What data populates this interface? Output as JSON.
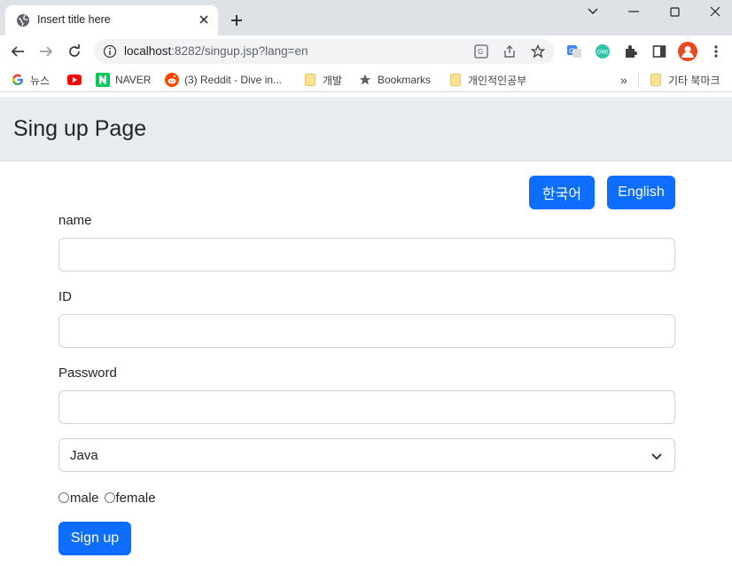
{
  "browser": {
    "tab": {
      "title": "Insert title here"
    },
    "address": {
      "host": "localhost",
      "rest": ":8282/singup.jsp?lang=en"
    },
    "bookmarks": [
      {
        "label": "뉴스",
        "icon": "google-icon"
      },
      {
        "label": "",
        "icon": "youtube-icon"
      },
      {
        "label": "NAVER",
        "icon": "naver-icon"
      },
      {
        "label": "(3) Reddit - Dive in...",
        "icon": "reddit-icon"
      },
      {
        "label": "개발",
        "icon": "folder-icon"
      },
      {
        "label": "Bookmarks",
        "icon": "star-icon"
      },
      {
        "label": "개인적인공부",
        "icon": "folder-icon"
      }
    ],
    "overflow": "»",
    "other_bookmarks": "기타 북마크"
  },
  "page": {
    "title": "Sing up Page",
    "lang_buttons": {
      "korean": "한국어",
      "english": "English"
    },
    "fields": {
      "name_label": "name",
      "id_label": "ID",
      "password_label": "Password"
    },
    "select": {
      "value": "Java"
    },
    "gender": {
      "male": "male",
      "female": "female"
    },
    "submit": "Sign up"
  },
  "colors": {
    "primary": "#0d6efd",
    "header_bg": "#e9ecef",
    "tabstrip_bg": "#dee1e6"
  }
}
